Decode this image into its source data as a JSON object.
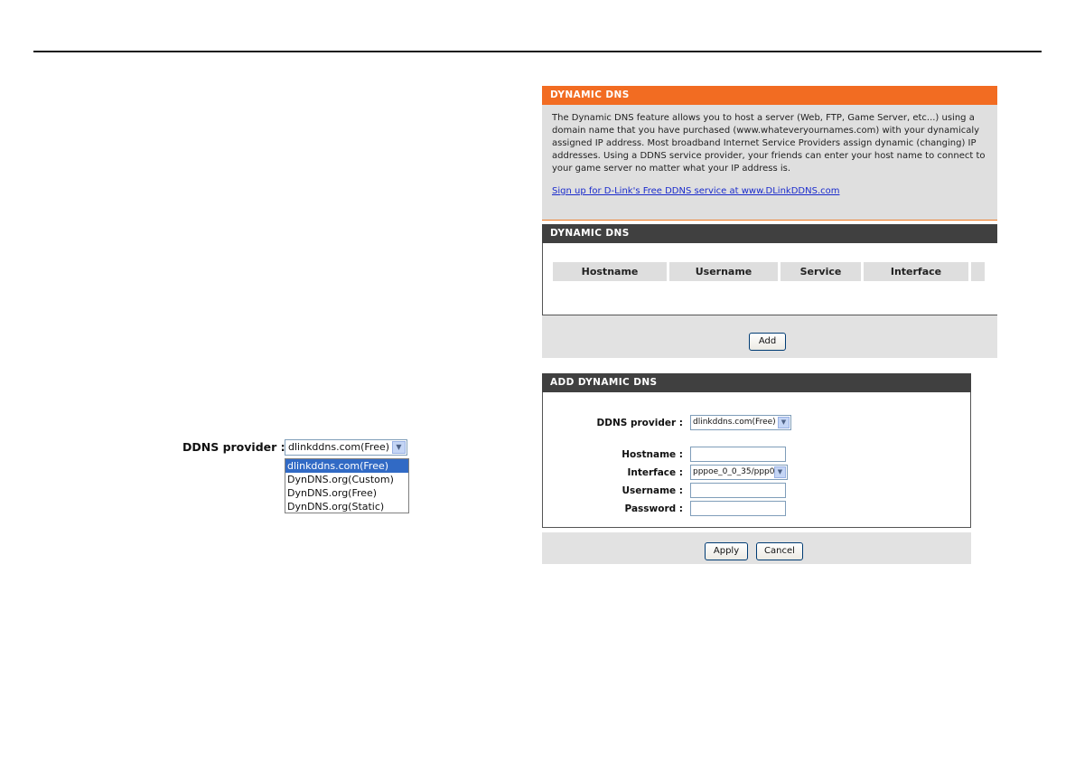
{
  "left_example": {
    "label": "DDNS provider :",
    "selected": "dlinkddns.com(Free)",
    "options": [
      "dlinkddns.com(Free)",
      "DynDNS.org(Custom)",
      "DynDNS.org(Free)",
      "DynDNS.org(Static)"
    ]
  },
  "info": {
    "title": "DYNAMIC DNS",
    "text": "The Dynamic DNS feature allows you to host a server (Web, FTP, Game Server, etc...) using a domain name that you have purchased (www.whateveryournames.com) with your dynamicaly assigned IP address. Most broadband Internet Service Providers assign dynamic (changing) IP addresses. Using a DDNS service provider, your friends can enter your host name to connect to your game server no matter what your IP address is.",
    "link": "Sign up for D-Link's Free DDNS service at www.DLinkDDNS.com"
  },
  "list": {
    "title": "DYNAMIC DNS",
    "columns": [
      "Hostname",
      "Username",
      "Service",
      "Interface"
    ],
    "add_label": "Add"
  },
  "form": {
    "title": "ADD DYNAMIC DNS",
    "provider_label": "DDNS provider :",
    "provider_value": "dlinkddns.com(Free)",
    "hostname_label": "Hostname :",
    "interface_label": "Interface :",
    "interface_value": "pppoe_0_0_35/ppp0",
    "username_label": "Username :",
    "password_label": "Password :",
    "apply_label": "Apply",
    "cancel_label": "Cancel"
  },
  "icons": {
    "dropdown": "chevron-down-icon"
  }
}
